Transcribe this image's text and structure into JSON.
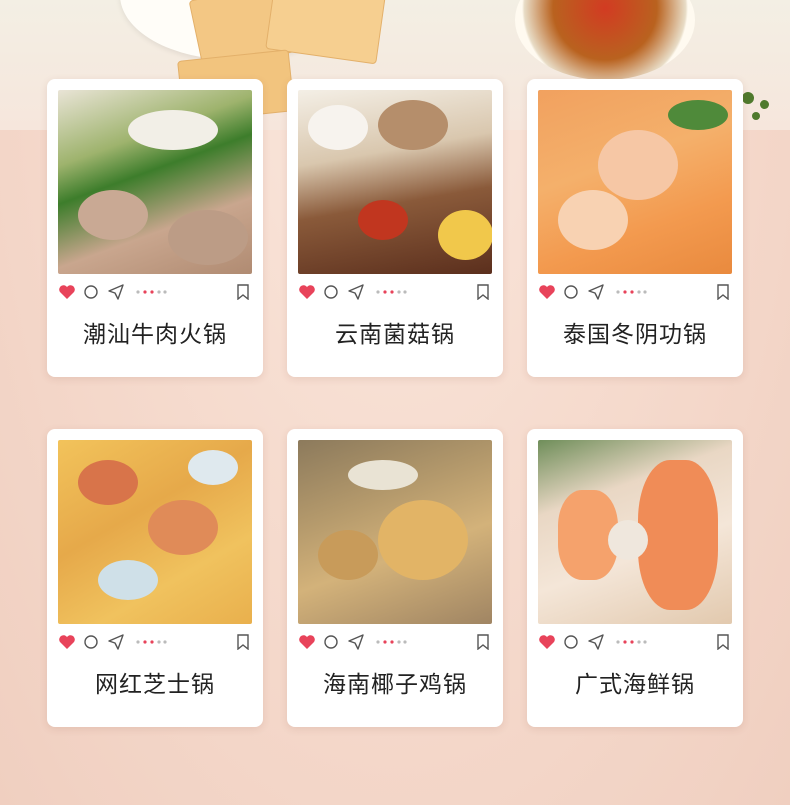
{
  "colors": {
    "heart": "#e8435a",
    "dots": "#e8435a",
    "icon_stroke": "#555555"
  },
  "cards": [
    {
      "title": "潮汕牛肉火锅",
      "photo": "beef-hotpot-photo"
    },
    {
      "title": "云南菌菇锅",
      "photo": "mushroom-hotpot-photo"
    },
    {
      "title": "泰国冬阴功锅",
      "photo": "tom-yum-hotpot-photo"
    },
    {
      "title": "网红芝士锅",
      "photo": "cheese-hotpot-photo"
    },
    {
      "title": "海南椰子鸡锅",
      "photo": "coconut-chicken-hotpot-photo"
    },
    {
      "title": "广式海鲜锅",
      "photo": "seafood-hotpot-photo"
    }
  ]
}
